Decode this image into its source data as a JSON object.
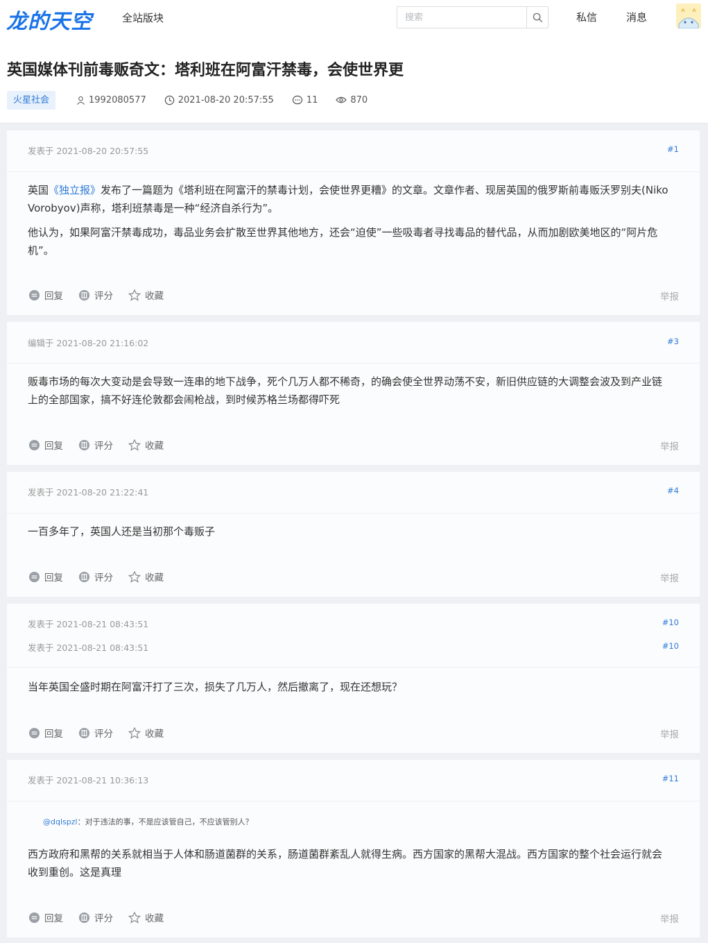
{
  "header": {
    "logo": "龙的天空",
    "nav_board": "全站版块",
    "search_placeholder": "搜索",
    "nav_pm": "私信",
    "nav_msg": "消息"
  },
  "thread": {
    "title": "英国媒体刊前毒贩奇文：塔利班在阿富汗禁毒，会使世界更",
    "tag": "火星社会",
    "author": "1992080577",
    "time": "2021-08-20 20:57:55",
    "replies": "11",
    "views": "870"
  },
  "actions": {
    "reply": "回复",
    "rate": "评分",
    "fav": "收藏",
    "report": "举报"
  },
  "posts": [
    {
      "time": "发表于 2021-08-20 20:57:55",
      "num": "#1",
      "p1_pre": "英国",
      "p1_link": "《独立报》",
      "p1_post": "发布了一篇题为《塔利班在阿富汗的禁毒计划，会使世界更糟》的文章。文章作者、现居英国的俄罗斯前毒贩沃罗别夫(Niko Vorobyov)声称，塔利班禁毒是一种“经济自杀行为”。",
      "p2": "他认为，如果阿富汗禁毒成功，毒品业务会扩散至世界其他地方，还会“迫使”一些吸毒者寻找毒品的替代品，从而加剧欧美地区的“阿片危机”。"
    },
    {
      "time": "编辑于 2021-08-20 21:16:02",
      "num": "#3",
      "text": "贩毒市场的每次大变动是会导致一连串的地下战争，死个几万人都不稀奇，的确会使全世界动荡不安，新旧供应链的大调整会波及到产业链上的全部国家，搞不好连伦敦都会闹枪战，到时候苏格兰场都得吓死"
    },
    {
      "time": "发表于 2021-08-20 21:22:41",
      "num": "#4",
      "text": "一百多年了，英国人还是当初那个毒贩子"
    },
    {
      "time": "发表于 2021-08-21 08:43:51",
      "time2": "发表于 2021-08-21 08:43:51",
      "num": "#10",
      "num2": "#10",
      "text": "当年英国全盛时期在阿富汗打了三次，损失了几万人，然后撤离了，现在还想玩？"
    },
    {
      "time": "发表于 2021-08-21 10:36:13",
      "num": "#11",
      "quote_user": "@dqlspzl",
      "quote_text": "：对于违法的事，不是应该管自己，不应该管别人？",
      "text": "西方政府和黑帮的关系就相当于人体和肠道菌群的关系，肠道菌群紊乱人就得生病。西方国家的黑帮大混战。西方国家的整个社会运行就会收到重创。这是真理"
    }
  ]
}
